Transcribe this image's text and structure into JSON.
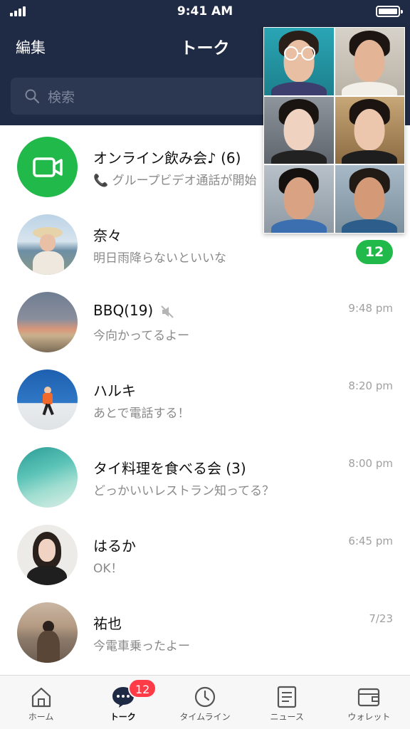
{
  "status_bar": {
    "time": "9:41 AM"
  },
  "header": {
    "edit_label": "編集",
    "title": "トーク"
  },
  "search": {
    "placeholder": "検索"
  },
  "chats": [
    {
      "name": "オンライン飲み会♪ (6)",
      "message": "📞 グループビデオ通話が開始",
      "time": "",
      "unread": "",
      "muted": false
    },
    {
      "name": "奈々",
      "message": "明日雨降らないといいな",
      "time": "",
      "unread": "12",
      "muted": false
    },
    {
      "name": "BBQ(19)",
      "message": "今向かってるよー",
      "time": "9:48 pm",
      "unread": "",
      "muted": true
    },
    {
      "name": "ハルキ",
      "message": "あとで電話する！",
      "time": "8:20 pm",
      "unread": "",
      "muted": false
    },
    {
      "name": "タイ料理を食べる会 (3)",
      "message": "どっかいいレストラン知ってる？",
      "time": "8:00 pm",
      "unread": "",
      "muted": false
    },
    {
      "name": "はるか",
      "message": "OK！",
      "time": "6:45 pm",
      "unread": "",
      "muted": false
    },
    {
      "name": "祐也",
      "message": "今電車乗ったよー",
      "time": "7/23",
      "unread": "",
      "muted": false
    }
  ],
  "tabs": [
    {
      "label": "ホーム",
      "icon": "home-icon"
    },
    {
      "label": "トーク",
      "icon": "chat-bubble-icon",
      "badge": "12"
    },
    {
      "label": "タイムライン",
      "icon": "clock-icon"
    },
    {
      "label": "ニュース",
      "icon": "news-icon"
    },
    {
      "label": "ウォレット",
      "icon": "wallet-icon"
    }
  ],
  "colors": {
    "header_bg": "#1f2a44",
    "accent_green": "#20b94a",
    "badge_red": "#ff3b48"
  }
}
